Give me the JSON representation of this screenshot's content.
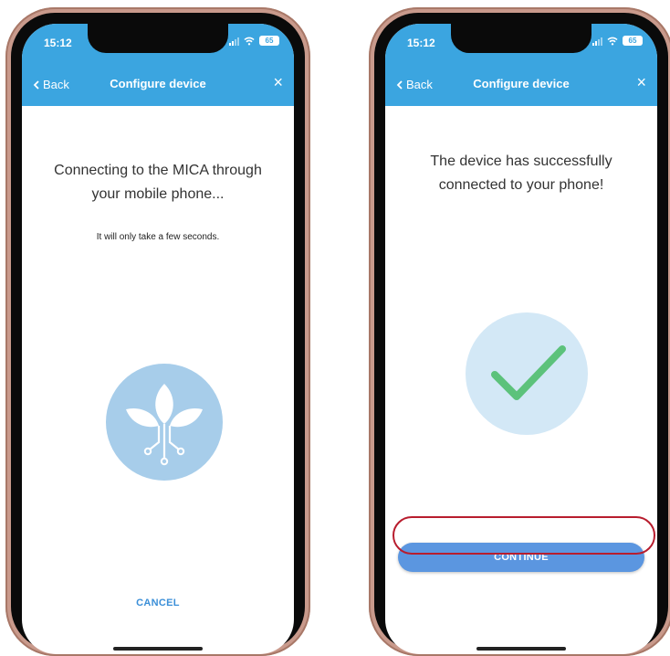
{
  "status": {
    "time": "15:12",
    "battery": "65"
  },
  "left_screen": {
    "back_label": "Back",
    "title": "Configure device",
    "close_glyph": "×",
    "headline_line1": "Connecting to the MICA through",
    "headline_line2": "your mobile phone...",
    "subline": "It will only take a few seconds.",
    "logo_icon": "mica-plant-icon",
    "cancel_label": "CANCEL"
  },
  "right_screen": {
    "back_label": "Back",
    "title": "Configure device",
    "close_glyph": "×",
    "headline_line1": "The device has successfully",
    "headline_line2": "connected to your phone!",
    "success_icon": "checkmark-icon",
    "continue_label": "CONTINUE"
  },
  "colors": {
    "header": "#3ba5e0",
    "continue_button": "#5b96e0",
    "cancel_text": "#3b8fd8",
    "checkmark": "#5cc27b",
    "highlight": "#b81d2e",
    "phone_frame": "#c99a8c"
  }
}
